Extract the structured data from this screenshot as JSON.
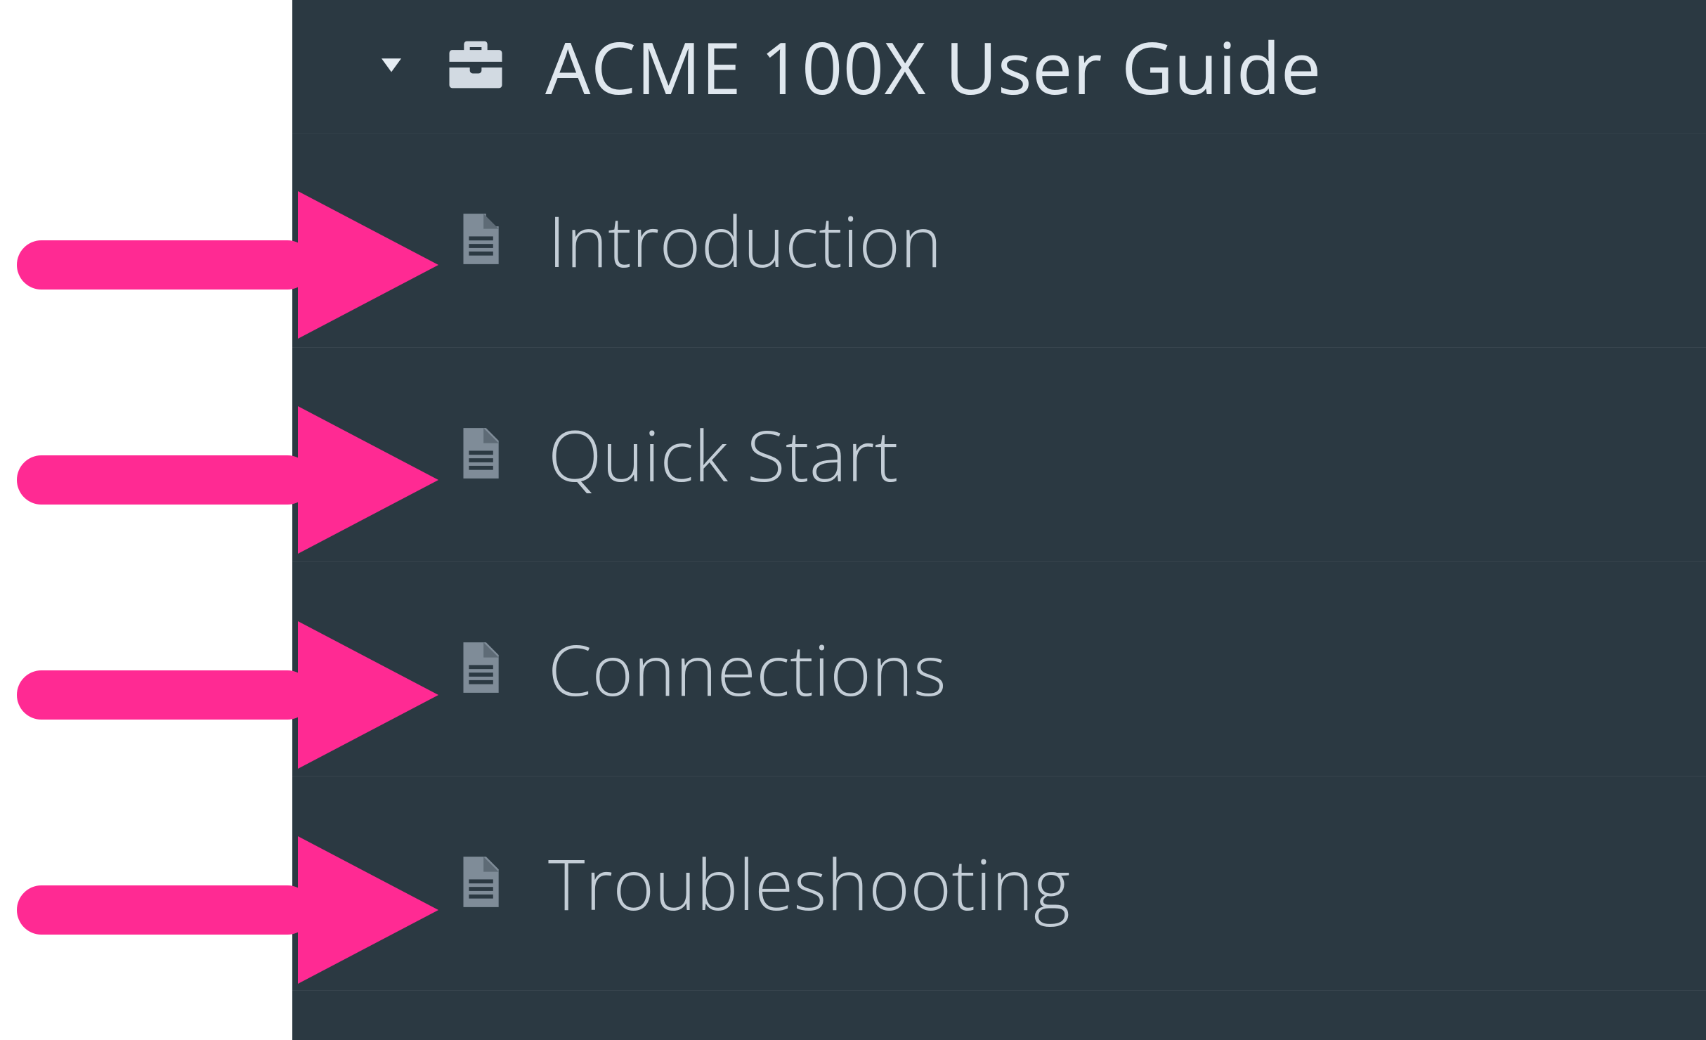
{
  "colors": {
    "panel_bg": "#2b3942",
    "text_primary": "#dfe7ee",
    "text_secondary": "#c3cdd6",
    "icon_muted": "#7f8c98",
    "icon_light": "#d2dae2",
    "callout": "#ff2a93"
  },
  "tree": {
    "root": {
      "label": "ACME 100X User Guide",
      "icon": "briefcase-icon",
      "expanded": true
    },
    "items": [
      {
        "label": "Introduction",
        "icon": "document-icon"
      },
      {
        "label": "Quick Start",
        "icon": "document-icon"
      },
      {
        "label": "Connections",
        "icon": "document-icon"
      },
      {
        "label": "Troubleshooting",
        "icon": "document-icon"
      }
    ]
  }
}
